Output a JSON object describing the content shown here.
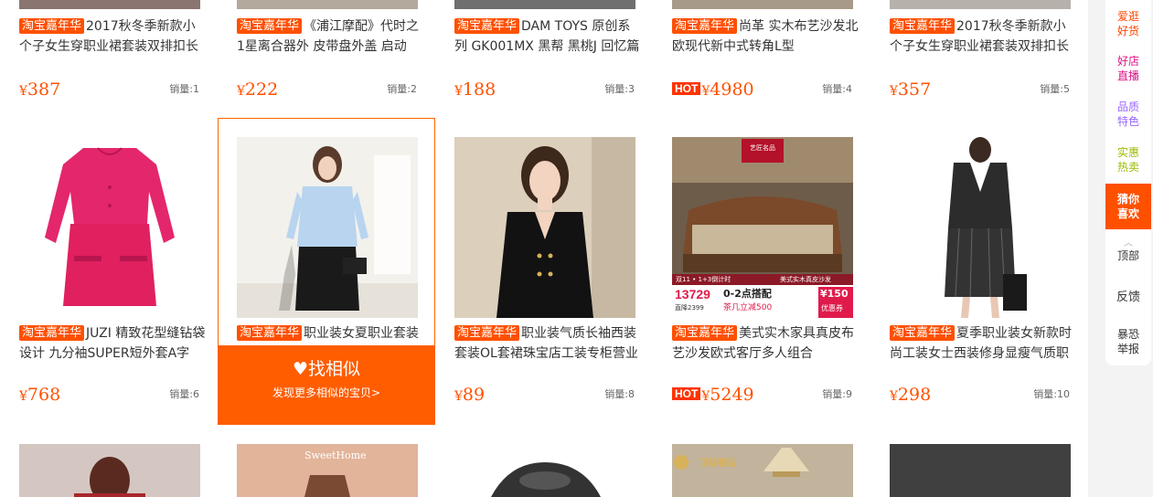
{
  "products": [
    {
      "title": "2017秋冬季新款小个子女生穿职业裙套装双排扣长袖",
      "tag": "淘宝嘉年华",
      "currency": "¥",
      "price": "387",
      "hot": "",
      "sales": "销量:1",
      "img": "dress-photo"
    },
    {
      "title": "《浦江摩配》代时之1星离合器外 皮带盘外盖 启动",
      "tag": "淘宝嘉年华",
      "currency": "¥",
      "price": "222",
      "hot": "",
      "sales": "销量:2",
      "img": "motor-part-photo"
    },
    {
      "title": "DAM TOYS 原创系列 GK001MX 黑帮 黑桃J 回忆篇",
      "tag": "淘宝嘉年华",
      "currency": "¥",
      "price": "188",
      "hot": "",
      "sales": "销量:3",
      "img": "figure-photo"
    },
    {
      "title": "尚革 实木布艺沙发北欧现代新中式转角L型",
      "tag": "淘宝嘉年华",
      "currency": "¥",
      "price": "4980",
      "hot": "HOT",
      "sales": "销量:4",
      "img": "sofa-photo"
    },
    {
      "title": "2017秋冬季新款小个子女生穿职业裙套装双排扣长袖",
      "tag": "淘宝嘉年华",
      "currency": "¥",
      "price": "357",
      "hot": "",
      "sales": "销量:5",
      "img": "suit-photo"
    },
    {
      "title": "JUZI 精致花型缝钻袋设计 九分袖SUPER短外套A字",
      "tag": "淘宝嘉年华",
      "currency": "¥",
      "price": "768",
      "hot": "",
      "sales": "销量:6",
      "img": "pink-suit-photo"
    },
    {
      "title": "职业装女夏职业套装",
      "tag": "淘宝嘉年华",
      "currency": "¥",
      "price": "",
      "hot": "",
      "sales": "",
      "img": "blue-shirt-photo"
    },
    {
      "title": "职业装气质长袖西装套装OL套裙珠宝店工装专柜营业",
      "tag": "淘宝嘉年华",
      "currency": "¥",
      "price": "89",
      "hot": "",
      "sales": "销量:8",
      "img": "black-blazer-photo"
    },
    {
      "title": "美式实木家具真皮布艺沙发欧式客厅多人组合",
      "tag": "淘宝嘉年华",
      "currency": "¥",
      "price": "5249",
      "hot": "HOT",
      "sales": "销量:9",
      "img": "european-sofa-photo"
    },
    {
      "title": "夏季职业装女新款时尚工装女士西装修身显瘦气质职",
      "tag": "淘宝嘉年华",
      "currency": "¥",
      "price": "298",
      "hot": "",
      "sales": "销量:10",
      "img": "pinstripe-suit-photo"
    }
  ],
  "overlay": {
    "heart_icon": "heart-icon",
    "find_similar": "找相似",
    "discover_more": "发现更多相似的宝贝>"
  },
  "sofa_ad": {
    "top_badge": "艺匠名品",
    "price_big": "13729",
    "price_small": "直降2399",
    "promo_line1": "0-2点搭配",
    "promo_line2": "茶几立减500",
    "coupon_value": "¥150",
    "coupon_label": "优惠券",
    "note": "双11 • 1+3倒计时",
    "caption": "美式实木真皮沙发"
  },
  "row3": {
    "sweet_text": "SweetHome",
    "ornate_text": "顶级奢品"
  },
  "sidebar": {
    "items": [
      {
        "line1": "爱逛",
        "line2": "好货",
        "color": "#ff4400"
      },
      {
        "line1": "好店",
        "line2": "直播",
        "color": "#dd1188"
      },
      {
        "line1": "品质",
        "line2": "特色",
        "color": "#9966ff"
      },
      {
        "line1": "实惠",
        "line2": "热卖",
        "color": "#99bb00"
      },
      {
        "line1": "猜你",
        "line2": "喜欢",
        "color": "#ffffff"
      }
    ],
    "top_label": "顶部",
    "feedback": "反馈",
    "report_line1": "暴恐",
    "report_line2": "举报"
  },
  "colors": {
    "accent": "#ff5000",
    "overlay": "#ff5d00",
    "sidebar_bg": "#f3f3f3"
  }
}
